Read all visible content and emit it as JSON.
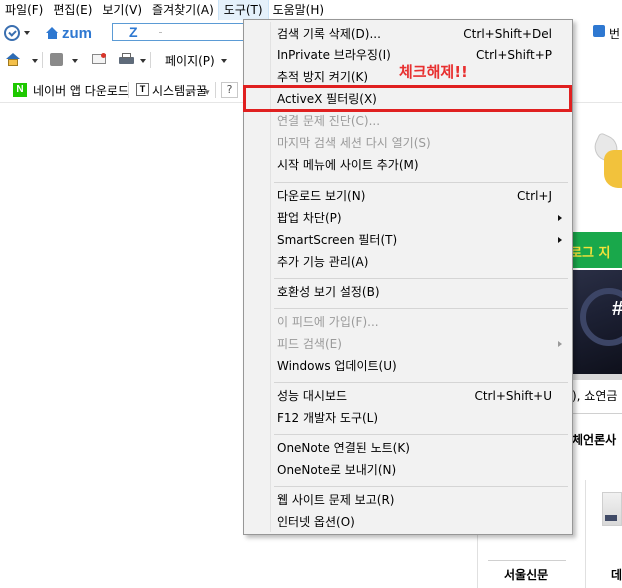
{
  "menubar": {
    "items": [
      "파일(F)",
      "편집(E)",
      "보기(V)",
      "즐겨찾기(A)",
      "도구(T)",
      "도움말(H)"
    ]
  },
  "addressbar": {
    "logo_text": "zum",
    "input_text": "Z",
    "right_text": "번"
  },
  "commandbar": {
    "page_label": "페이지(P)"
  },
  "favorites": {
    "naver_icon": "N",
    "naver_label": "네이버 앱 다운로드",
    "sys_icon": "T",
    "sys_label": "시스템긁꿀",
    "help_label": "?"
  },
  "tools_menu": {
    "items": [
      {
        "label": "검색 기록 삭제(D)...",
        "shortcut": "Ctrl+Shift+Del"
      },
      {
        "label": "InPrivate 브라우징(I)",
        "shortcut": "Ctrl+Shift+P"
      },
      {
        "label": "추적 방지 켜기(K)",
        "shortcut": ""
      },
      {
        "label": "ActiveX 필터링(X)",
        "shortcut": ""
      },
      {
        "label": "연결 문제 진단(C)...",
        "shortcut": "",
        "disabled": true
      },
      {
        "label": "마지막 검색 세션 다시 열기(S)",
        "shortcut": "",
        "disabled": true
      },
      {
        "label": "시작 메뉴에 사이트 추가(M)",
        "shortcut": ""
      },
      {
        "label": "다운로드 보기(N)",
        "shortcut": "Ctrl+J"
      },
      {
        "label": "팝업 차단(P)",
        "shortcut": "",
        "submenu": true
      },
      {
        "label": "SmartScreen 필터(T)",
        "shortcut": "",
        "submenu": true
      },
      {
        "label": "추가 기능 관리(A)",
        "shortcut": ""
      },
      {
        "label": "호환성 보기 설정(B)",
        "shortcut": ""
      },
      {
        "label": "이 피드에 가입(F)...",
        "shortcut": "",
        "disabled": true
      },
      {
        "label": "피드 검색(E)",
        "shortcut": "",
        "disabled": true,
        "submenu": true
      },
      {
        "label": "Windows 업데이트(U)",
        "shortcut": ""
      },
      {
        "label": "성능 대시보드",
        "shortcut": "Ctrl+Shift+U"
      },
      {
        "label": "F12 개발자 도구(L)",
        "shortcut": ""
      },
      {
        "label": "OneNote 연결된 노트(K)",
        "shortcut": ""
      },
      {
        "label": "OneNote로 보내기(N)",
        "shortcut": ""
      },
      {
        "label": "웹 사이트 문제 보고(R)",
        "shortcut": ""
      },
      {
        "label": "인터넷 옵션(O)",
        "shortcut": ""
      }
    ]
  },
  "annotation": {
    "text": "체크해제!!",
    "color": "#e83030"
  },
  "page_content": {
    "banner_text": "로그 지",
    "banner_hash": "#",
    "comma_text": "), 쇼연금",
    "press_text": "체언론사",
    "seoul_text": "서울신문",
    "edge_text": "데"
  },
  "colors": {
    "highlight_border": "#e02020",
    "menu_bg": "#f2f2f2",
    "accent_blue": "#2e78d1",
    "banner_green": "#19a84b"
  }
}
